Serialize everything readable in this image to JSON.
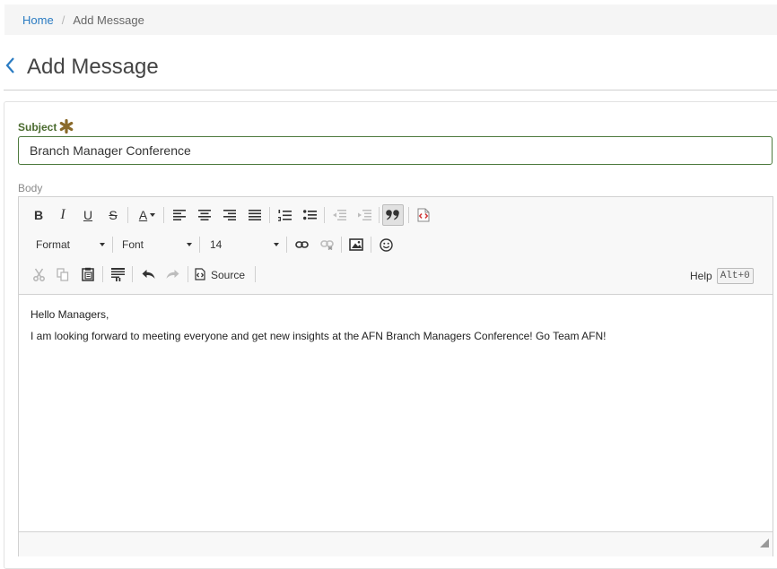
{
  "breadcrumb": {
    "home": "Home",
    "separator": "/",
    "current": "Add Message"
  },
  "page": {
    "title": "Add Message"
  },
  "subject": {
    "label": "Subject",
    "value": "Branch Manager Conference"
  },
  "body_field": {
    "label": "Body"
  },
  "toolbar": {
    "bold": "B",
    "italic": "I",
    "underline": "U",
    "strike": "S",
    "text_color": "A",
    "format_label": "Format",
    "font_label": "Font",
    "size_value": "14",
    "source_label": "Source",
    "help_label": "Help",
    "help_shortcut": "Alt+0"
  },
  "editor_content": {
    "greeting": "Hello Managers,",
    "message": "I am looking forward to meeting everyone and get new insights at the AFN Branch Managers Conference! Go Team AFN!"
  },
  "colors": {
    "link": "#2a7bc2",
    "label_green": "#4a6a2e",
    "required": "#8a6a2a",
    "border_green": "#4d7a3e"
  }
}
